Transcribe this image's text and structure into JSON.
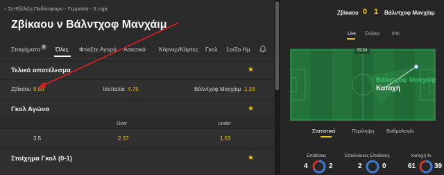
{
  "breadcrumb": "Σε-Εξέλιξη Ποδόσφαιρο - Γερμανία - 3.Liga",
  "match_title": "Ζβίκαου ν Βάλντχοφ Μανχάιμ",
  "tabs": [
    {
      "label": "Στοιχήματα",
      "badge": "3"
    },
    {
      "label": "Όλες"
    },
    {
      "label": "Φτιάξτε Αγορά"
    },
    {
      "label": "Ασιατικά"
    },
    {
      "label": "Κόρνερ/Κάρτες"
    },
    {
      "label": "Γκολ"
    },
    {
      "label": "1ο/2ο Ημ"
    }
  ],
  "markets": {
    "final_result": {
      "title": "Τελικό αποτέλεσμα",
      "outcomes": [
        {
          "label": "Ζβίκαου",
          "odds": "9.50"
        },
        {
          "label": "Ισοπαλία",
          "odds": "4.75"
        },
        {
          "label": "Βάλντχοφ Μανχάιμ",
          "odds": "1.33"
        }
      ]
    },
    "match_goals": {
      "title": "Γκολ Αγώνα",
      "over_label": "Over",
      "under_label": "Under",
      "line": "3.5",
      "over_odds": "2.37",
      "under_odds": "1.53"
    },
    "goal_bet": {
      "title": "Στοίχημα Γκολ (0-1)"
    }
  },
  "scoreboard": {
    "home": "Ζβίκαου",
    "home_score": "0",
    "away_score": "1",
    "away": "Βάλντχοφ Μανχάιμ"
  },
  "live_tabs": [
    "Live",
    "Σκόρερ",
    "Info"
  ],
  "pitch": {
    "clock": "09:04",
    "event_team": "Βάλντχοφ Μανχάιμ",
    "event_type": "Κατοχή"
  },
  "stats_tabs": [
    "Στατιστικά",
    "Περίληψη",
    "Βαθμολογία"
  ],
  "stats": [
    {
      "title": "Επιθέσεις",
      "home": "4",
      "away": "2",
      "home_fraction": 0.67
    },
    {
      "title": "Επικίνδυνες Επιθέσεις",
      "home": "2",
      "away": "0",
      "home_fraction": 1.0
    },
    {
      "title": "Κατοχή %",
      "home": "61",
      "away": "39",
      "home_fraction": 0.61
    }
  ],
  "colors": {
    "accent": "#f2c200",
    "home_ring": "#3a7bd5",
    "away_ring": "#d8322c",
    "pitch_green": "#1f6a35",
    "event_green": "#39c06a",
    "annotation_arrow": "#e02020"
  }
}
